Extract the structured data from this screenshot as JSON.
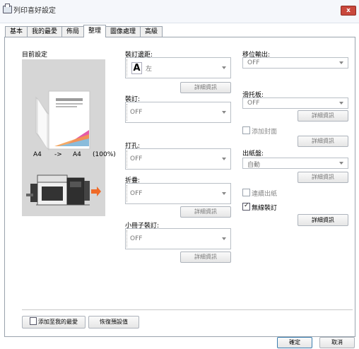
{
  "window": {
    "title": "列印喜好設定",
    "close_label": "x"
  },
  "tabs": [
    {
      "label": "基本"
    },
    {
      "label": "我的最愛"
    },
    {
      "label": "佈局"
    },
    {
      "label": "整理"
    },
    {
      "label": "圖像處理"
    },
    {
      "label": "高級"
    }
  ],
  "left": {
    "heading": "目前設定",
    "paper_from": "A4",
    "arrow": "->",
    "paper_to": "A4",
    "scale": "(100%)"
  },
  "mid": {
    "binding_margin_label": "裝訂邊距:",
    "binding_margin_value": "左",
    "binding_margin_detail": "詳細資訊",
    "staple_label": "裝訂:",
    "staple_value": "OFF",
    "punch_label": "打孔:",
    "punch_value": "OFF",
    "fold_label": "折疊:",
    "fold_value": "OFF",
    "fold_detail": "詳細資訊",
    "booklet_label": "小冊子裝訂:",
    "booklet_value": "OFF",
    "booklet_detail": "詳細資訊"
  },
  "right": {
    "offset_label": "移位輸出:",
    "offset_value": "OFF",
    "tray_label": "滑托板:",
    "tray_value": "OFF",
    "tray_detail": "詳細資訊",
    "cover_label": "添加封面",
    "cover_detail": "詳細資訊",
    "output_label": "出紙盤:",
    "output_value": "自動",
    "output_detail": "詳細資訊",
    "continuous_label": "連續出紙",
    "seamless_label": "無線裝訂",
    "seamless_checked": true,
    "seamless_detail": "詳細資訊"
  },
  "footer": {
    "add_favorites": "添加至我的最愛",
    "restore_default": "恢復預設值",
    "ok": "確定",
    "cancel": "取消"
  }
}
